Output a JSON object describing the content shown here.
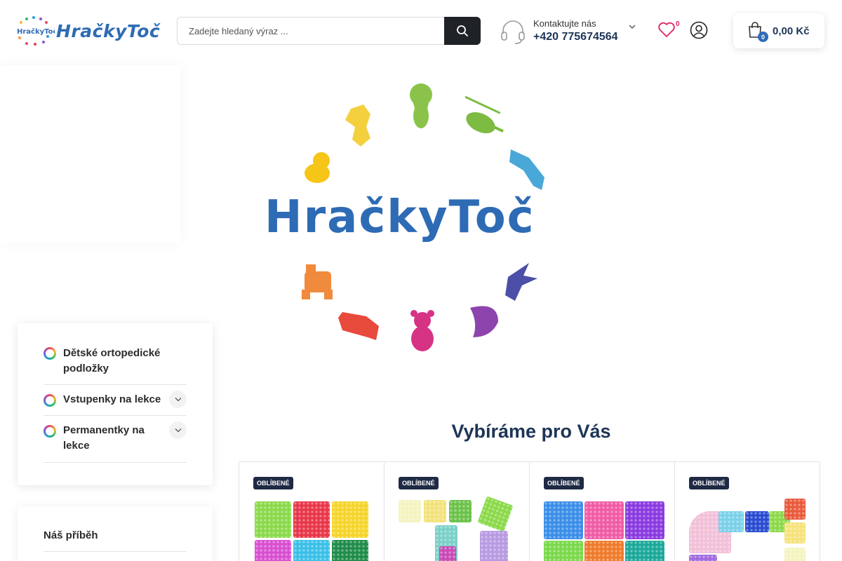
{
  "header": {
    "logo_text": "HračkyToč",
    "search": {
      "placeholder": "Zadejte hledaný výraz ..."
    },
    "contact": {
      "label": "Kontaktujte nás",
      "phone": "+420 775674564"
    },
    "wishlist": {
      "count": "0"
    },
    "cart": {
      "count": "0",
      "total": "0,00 Kč"
    }
  },
  "hero": {
    "brand": "HračkyToč"
  },
  "sidebar": {
    "categories": [
      {
        "label": "Dětské ortopedické podložky",
        "has_toggle": false
      },
      {
        "label": "Vstupenky na lekce",
        "has_toggle": true
      },
      {
        "label": "Permanentky na lekce",
        "has_toggle": true
      }
    ],
    "story": {
      "title": "Náš příběh"
    }
  },
  "featured": {
    "title": "Vybíráme pro Vás",
    "products": [
      {
        "badge": "OBLÍBENÉ"
      },
      {
        "badge": "OBLÍBENÉ"
      },
      {
        "badge": "OBLÍBENÉ"
      },
      {
        "badge": "OBLÍBENÉ"
      }
    ]
  },
  "colors": {
    "brand_blue": "#2e6bb5",
    "dark_navy": "#1d3557",
    "badge_bg": "#1f2a44",
    "accent_pink": "#e0245e"
  }
}
